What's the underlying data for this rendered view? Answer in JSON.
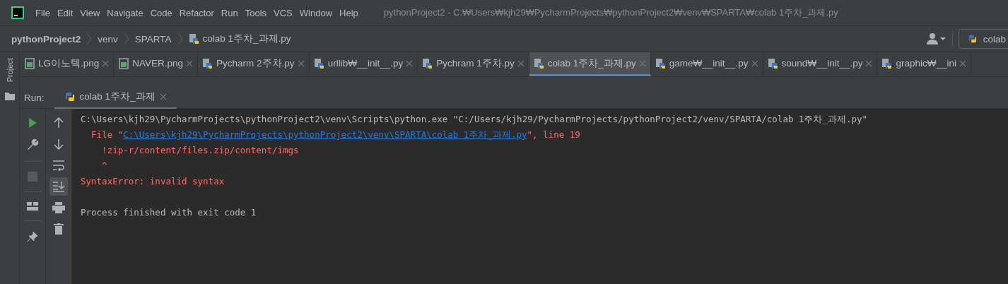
{
  "menu": [
    "File",
    "Edit",
    "View",
    "Navigate",
    "Code",
    "Refactor",
    "Run",
    "Tools",
    "VCS",
    "Window",
    "Help"
  ],
  "window": {
    "title": "pythonProject2 - C:₩Users₩kjh29₩PycharmProjects₩pythonProject2₩venv₩SPARTA₩colab 1주차_과제.py"
  },
  "breadcrumb": [
    {
      "label": "pythonProject2",
      "kind": "project"
    },
    {
      "label": "venv",
      "kind": "folder"
    },
    {
      "label": "SPARTA",
      "kind": "folder"
    },
    {
      "label": "colab 1주차_과제.py",
      "kind": "python"
    }
  ],
  "run_config": {
    "label": "colab"
  },
  "side_stripe": {
    "label": "Project"
  },
  "tabs": [
    {
      "label": "LG이노텍.png",
      "kind": "image",
      "selected": false
    },
    {
      "label": "NAVER.png",
      "kind": "image",
      "selected": false
    },
    {
      "label": "Pycharm 2주차.py",
      "kind": "python",
      "selected": false
    },
    {
      "label": "urllib₩__init__.py",
      "kind": "python",
      "selected": false
    },
    {
      "label": "Pychram 1주차.py",
      "kind": "python",
      "selected": false
    },
    {
      "label": "colab 1주차_과제.py",
      "kind": "python",
      "selected": true
    },
    {
      "label": "game₩__init__.py",
      "kind": "python",
      "selected": false
    },
    {
      "label": "sound₩__init__.py",
      "kind": "python",
      "selected": false
    },
    {
      "label": "graphic₩__ini",
      "kind": "python",
      "selected": false
    }
  ],
  "run_panel": {
    "label": "Run:",
    "tabs": [
      {
        "label": "colab 1주차_과제",
        "selected": true
      }
    ]
  },
  "console": [
    {
      "kind": "command",
      "segments": [
        {
          "kind": "plain",
          "text": "C:\\Users\\kjh29\\PycharmProjects\\pythonProject2\\venv\\Scripts\\python.exe \"C:/Users/kjh29/PycharmProjects/pythonProject2/venv/SPARTA/colab 1주차_과제.py\""
        }
      ]
    },
    {
      "kind": "trace",
      "segments": [
        {
          "kind": "error",
          "text": "  File \""
        },
        {
          "kind": "link",
          "text": "C:\\Users\\kjh29\\PycharmProjects\\pythonProject2\\venv\\SPARTA\\colab 1주차_과제.py"
        },
        {
          "kind": "error",
          "text": "\", line 19"
        }
      ]
    },
    {
      "kind": "trace",
      "segments": [
        {
          "kind": "error",
          "text": "    !zip-r/content/files.zip/content/imgs"
        }
      ]
    },
    {
      "kind": "trace",
      "segments": [
        {
          "kind": "error",
          "text": "    ^"
        }
      ]
    },
    {
      "kind": "trace",
      "segments": [
        {
          "kind": "error",
          "text": "SyntaxError: invalid syntax"
        }
      ]
    },
    {
      "kind": "exit",
      "segments": [
        {
          "kind": "plain",
          "text": "Process finished with exit code 1"
        }
      ]
    }
  ]
}
